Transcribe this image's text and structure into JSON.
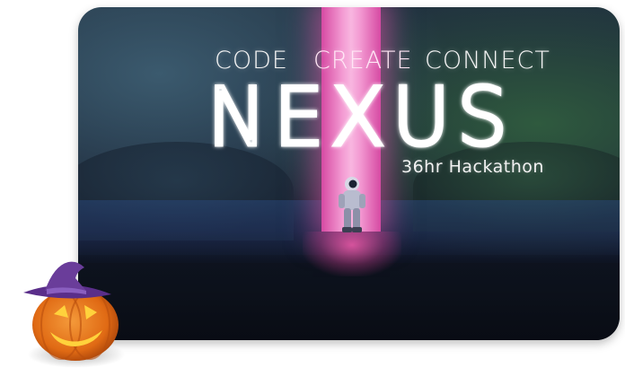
{
  "banner": {
    "tagline": [
      "CODE",
      "CREATE",
      "CONNECT"
    ],
    "title": "NEXUS",
    "subtitle": "36hr Hackathon"
  },
  "colors": {
    "beam": "#f39ad2",
    "neon_text": "#ffffff",
    "pumpkin": "#e8731a",
    "hat": "#6a3d9a"
  },
  "icons": [
    "astronaut-figure",
    "pumpkin-icon",
    "witch-hat-icon"
  ]
}
